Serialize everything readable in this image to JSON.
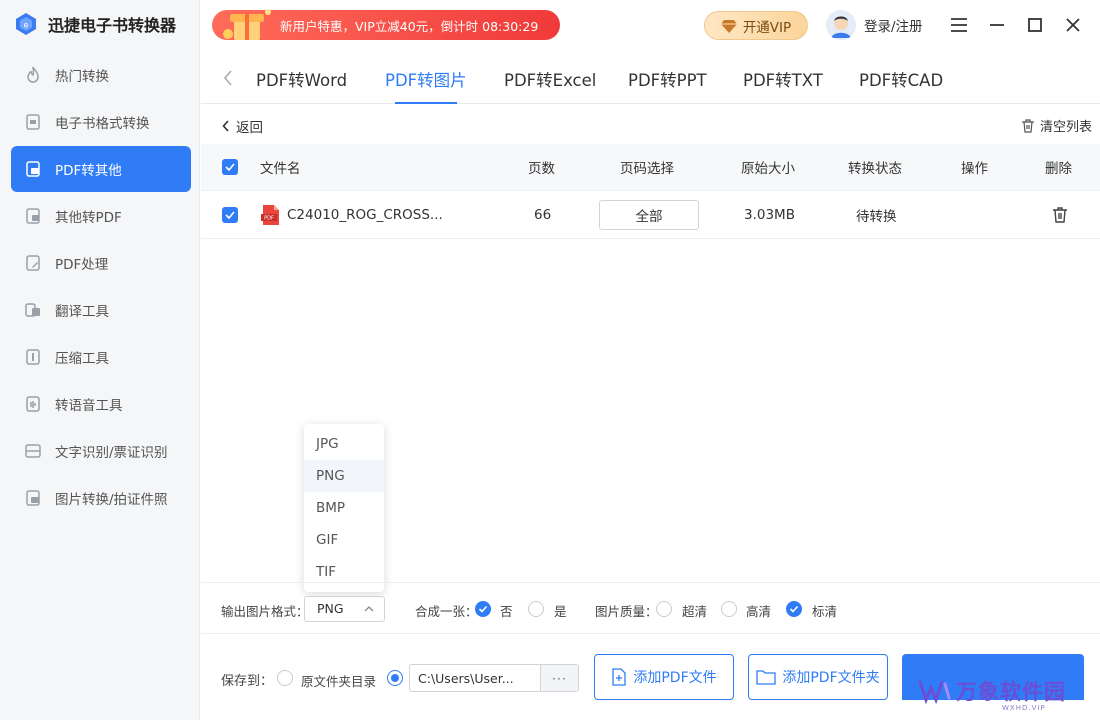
{
  "app": {
    "title": "迅捷电子书转换器"
  },
  "promo": {
    "text": "新用户特惠，VIP立减40元，倒计时 08:30:29"
  },
  "header": {
    "vip_label": "开通VIP",
    "login_label": "登录/注册"
  },
  "sidebar": {
    "items": [
      {
        "label": "热门转换",
        "icon": "flame-icon"
      },
      {
        "label": "电子书格式转换",
        "icon": "ebook-icon"
      },
      {
        "label": "PDF转其他",
        "icon": "pdf-convert-icon",
        "active": true
      },
      {
        "label": "其他转PDF",
        "icon": "to-pdf-icon"
      },
      {
        "label": "PDF处理",
        "icon": "pdf-edit-icon"
      },
      {
        "label": "翻译工具",
        "icon": "translate-icon"
      },
      {
        "label": "压缩工具",
        "icon": "compress-icon"
      },
      {
        "label": "转语音工具",
        "icon": "voice-icon"
      },
      {
        "label": "文字识别/票证识别",
        "icon": "ocr-icon"
      },
      {
        "label": "图片转换/拍证件照",
        "icon": "image-icon"
      }
    ]
  },
  "tabs": [
    "PDF转Word",
    "PDF转图片",
    "PDF转Excel",
    "PDF转PPT",
    "PDF转TXT",
    "PDF转CAD"
  ],
  "active_tab": "PDF转图片",
  "toolbar": {
    "back_label": "返回",
    "clear_label": "清空列表"
  },
  "table": {
    "headers": {
      "filename": "文件名",
      "pages": "页数",
      "page_select": "页码选择",
      "size": "原始大小",
      "status": "转换状态",
      "ops": "操作",
      "delete": "删除"
    },
    "rows": [
      {
        "filename": "C24010_ROG_CROSS...",
        "pages": "66",
        "page_select": "全部",
        "size": "3.03MB",
        "status": "待转换"
      }
    ]
  },
  "format_dropdown": {
    "options": [
      "JPG",
      "PNG",
      "BMP",
      "GIF",
      "TIF"
    ],
    "selected": "PNG"
  },
  "options": {
    "format_label": "输出图片格式：",
    "format_value": "PNG",
    "merge_label": "合成一张：",
    "merge_no": "否",
    "merge_yes": "是",
    "quality_label": "图片质量：",
    "quality_high": "超清",
    "quality_mid": "高清",
    "quality_std": "标清"
  },
  "save": {
    "label": "保存到：",
    "option_source": "原文件夹目录",
    "path": "C:\\Users\\User...",
    "more": "···",
    "add_file": "添加PDF文件",
    "add_folder": "添加PDF文件夹"
  },
  "watermark": {
    "text": "万象软件园",
    "sub": "WXHD.VIP"
  },
  "colors": {
    "accent": "#2f7cf6",
    "promo": "#f03a3a",
    "vip": "#fbd59a"
  }
}
